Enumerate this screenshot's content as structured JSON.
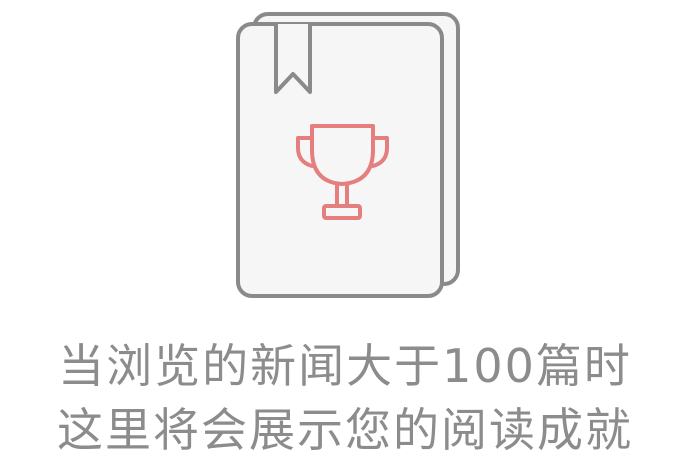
{
  "empty_state": {
    "illustration_icon": "book-with-trophy-icon",
    "colors": {
      "book_stroke": "#8a8a8a",
      "book_fill": "#f6f6f6",
      "trophy_stroke": "#e57f7f",
      "text": "#8c8c8c",
      "background": "#ffffff"
    },
    "message_line1": "当浏览的新闻大于100篇时",
    "message_line2": "这里将会展示您的阅读成就"
  }
}
